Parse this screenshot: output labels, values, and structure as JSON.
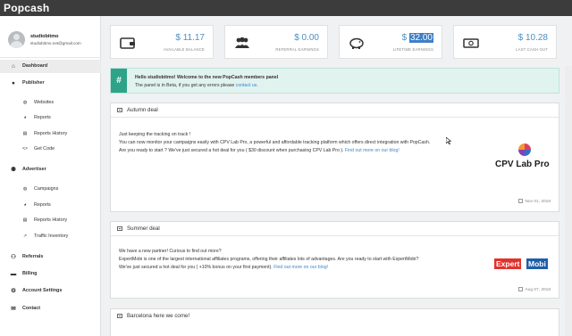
{
  "brand": {
    "name": "Popcash"
  },
  "user": {
    "name": "studiobitmo",
    "email": "studiobitmo.net@gmail.com"
  },
  "sidebar": {
    "items": [
      {
        "label": "Dashboard",
        "icon": "home-icon",
        "level": "main",
        "active": true
      },
      {
        "label": "Publisher",
        "icon": "user-icon",
        "level": "main"
      },
      {
        "label": "Websites",
        "icon": "globe-icon",
        "level": "sub"
      },
      {
        "label": "Reports",
        "icon": "pie-chart-icon",
        "level": "sub"
      },
      {
        "label": "Reports History",
        "icon": "list-icon",
        "level": "sub"
      },
      {
        "label": "Get Code",
        "icon": "code-icon",
        "level": "sub"
      },
      {
        "label": "Advertiser",
        "icon": "users-icon",
        "level": "main"
      },
      {
        "label": "Campaigns",
        "icon": "globe-icon",
        "level": "sub"
      },
      {
        "label": "Reports",
        "icon": "pie-chart-icon",
        "level": "sub"
      },
      {
        "label": "Reports History",
        "icon": "list-icon",
        "level": "sub"
      },
      {
        "label": "Traffic Inventory",
        "icon": "trend-icon",
        "level": "sub"
      },
      {
        "label": "Referrals",
        "icon": "referrals-icon",
        "level": "main"
      },
      {
        "label": "Billing",
        "icon": "billing-icon",
        "level": "main"
      },
      {
        "label": "Account Settings",
        "icon": "gear-icon",
        "level": "main"
      },
      {
        "label": "Contact",
        "icon": "envelope-icon",
        "level": "main"
      }
    ]
  },
  "stats": [
    {
      "value": "$ 11.17",
      "label": "AVAILABLE BALANCE",
      "icon": "wallet-icon"
    },
    {
      "value": "$ 0.00",
      "label": "REFERRAL EARNINGS",
      "icon": "people-icon"
    },
    {
      "value_prefix": "$ ",
      "value_highlight": "32.00",
      "label": "LIFETIME EARNINGS",
      "icon": "piggy-bank-icon"
    },
    {
      "value": "$ 10.28",
      "label": "LAST CASH OUT",
      "icon": "cash-icon"
    }
  ],
  "welcome": {
    "badge": "#",
    "greeting": "Hello studiobitmo! Welcome to the new PopCash members panel",
    "line2_text": "The panel is in Beta, if you get any errors please ",
    "line2_link": "contact us."
  },
  "panels": [
    {
      "title": "Autumn deal",
      "lines": [
        "Just keeping the tracking on track !",
        "You can now monitor your campaigns easily with CPV Lab Pro, a powerful and affordable tracking platform which offers direct integration with PopCash.",
        "Are you ready to start ? We've just secured a hot deal for you ( $30 discount when purchasing CPV Lab Pro ). "
      ],
      "link": "Find out more on our blog!",
      "logo_text": "CPV Lab Pro",
      "date": "Nov 01, 2018"
    },
    {
      "title": "Summer deal",
      "lines": [
        "We have a new partner! Curious to find out more?",
        "ExpertMobi is one of the largest international affiliates programs, offering their affiliates lots of advantages. Are you ready to start with ExpertMobi?",
        "We've just secured a hot deal for you ( +10% bonus on your first payment). "
      ],
      "link": "Find out more on our blog!",
      "logo_text_a": "Expert",
      "logo_text_b": "Mobi",
      "date": "Aug 07, 2018"
    },
    {
      "title": "Barcelona here we come!"
    }
  ],
  "colors": {
    "topbar": "#3c3c3c",
    "accent": "#2ea388",
    "value": "#4a90c4",
    "link": "#3a86c8"
  }
}
